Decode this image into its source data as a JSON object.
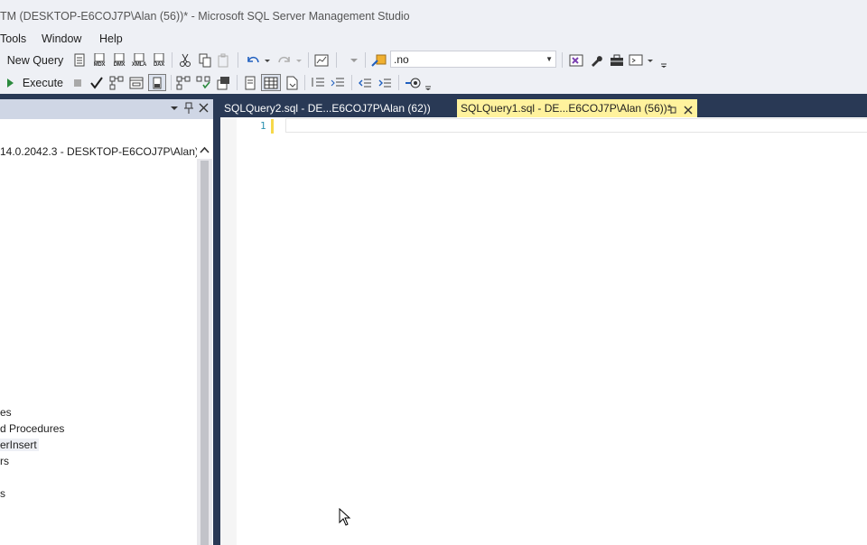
{
  "window": {
    "title": "TM (DESKTOP-E6COJ7P\\Alan (56))* - Microsoft SQL Server Management Studio"
  },
  "menu": {
    "items": [
      "Tools",
      "Window",
      "Help"
    ]
  },
  "toolbar1": {
    "new_query_label": "New Query",
    "icon_labels": [
      "MDX",
      "DMX",
      "XMLA",
      "DAX"
    ],
    "database_value": ".no"
  },
  "toolbar2": {
    "execute_label": "Execute"
  },
  "object_explorer": {
    "server_node": "14.0.2042.3 - DESKTOP-E6COJ7P\\Alan)",
    "tree_items": [
      "es",
      "d Procedures",
      "erInsert",
      "rs",
      "s"
    ]
  },
  "tabs": [
    {
      "label": "SQLQuery2.sql - DE...E6COJ7P\\Alan (62))",
      "active": false
    },
    {
      "label": "SQLQuery1.sql - DE...E6COJ7P\\Alan (56))*",
      "active": true
    }
  ],
  "editor": {
    "line_number": "1",
    "content": ""
  },
  "colors": {
    "accent_dark": "#293955",
    "active_tab": "#fff29d",
    "background": "#eef0f5"
  }
}
